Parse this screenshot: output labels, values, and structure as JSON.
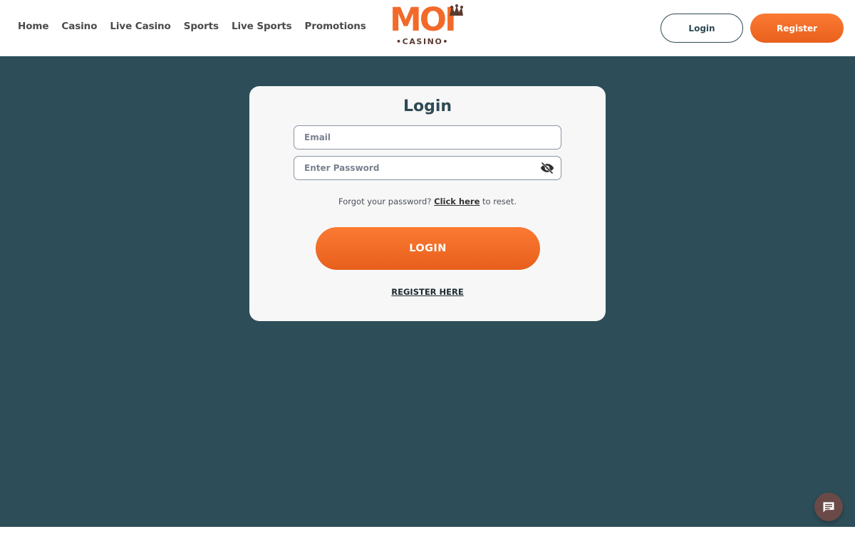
{
  "nav": {
    "items": [
      {
        "label": "Home"
      },
      {
        "label": "Casino"
      },
      {
        "label": "Live Casino"
      },
      {
        "label": "Sports"
      },
      {
        "label": "Live Sports"
      },
      {
        "label": "Promotions"
      }
    ]
  },
  "logo": {
    "text": "MOI",
    "subtext": "CASINO"
  },
  "header": {
    "login_label": "Login",
    "register_label": "Register"
  },
  "login_form": {
    "title": "Login",
    "email_placeholder": "Email",
    "email_value": "",
    "password_placeholder": "Enter Password",
    "password_value": "",
    "forgot_prefix": "Forgot your password?",
    "forgot_link": "Click here",
    "forgot_suffix": "to reset.",
    "submit_label": "LOGIN",
    "register_link": "REGISTER HERE"
  },
  "icons": {
    "password_toggle": "eye-slash-icon",
    "chat": "chat-icon",
    "jester": "jester-hat-icon"
  },
  "colors": {
    "accent": "#f26a2a",
    "background": "#2d4e58",
    "card": "#f7f7f7",
    "heading": "#2e4a54",
    "chat_button": "#6a4a47"
  }
}
